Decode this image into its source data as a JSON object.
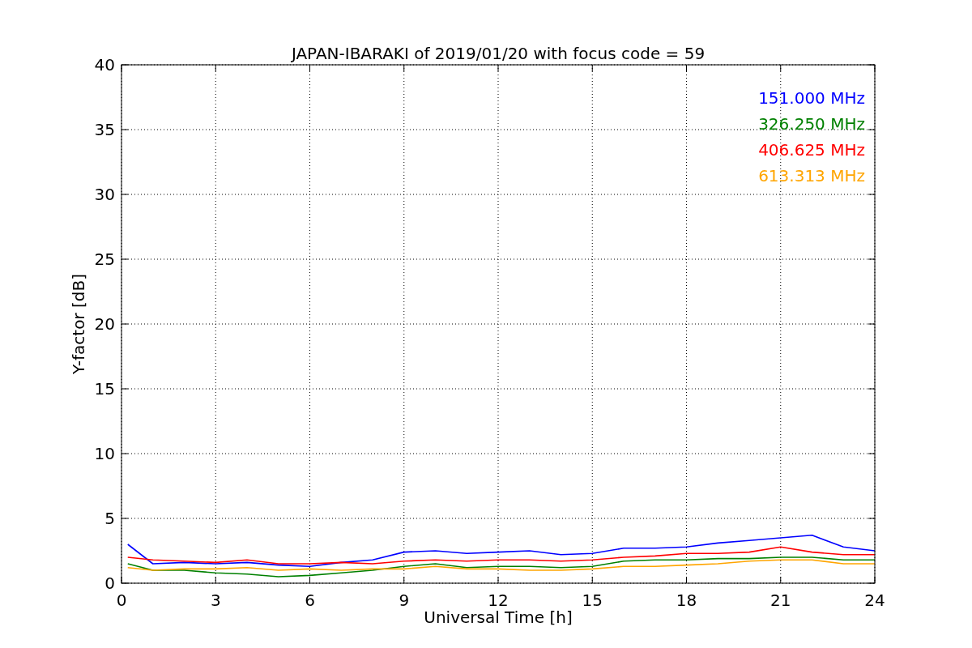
{
  "chart_data": {
    "type": "line",
    "title": "JAPAN-IBARAKI of 2019/01/20 with focus code = 59",
    "xlabel": "Universal Time [h]",
    "ylabel": "Y-factor [dB]",
    "x": [
      0.2,
      1,
      2,
      3,
      4,
      5,
      6,
      7,
      8,
      9,
      10,
      11,
      12,
      13,
      14,
      15,
      16,
      17,
      18,
      19,
      20,
      21,
      22,
      23,
      24
    ],
    "series": [
      {
        "name": "151.000 MHz",
        "color": "#0000ff",
        "values": [
          3.0,
          1.5,
          1.6,
          1.5,
          1.6,
          1.4,
          1.3,
          1.6,
          1.8,
          2.4,
          2.5,
          2.3,
          2.4,
          2.5,
          2.2,
          2.3,
          2.7,
          2.7,
          2.8,
          3.1,
          3.3,
          3.5,
          3.7,
          2.8,
          2.5
        ]
      },
      {
        "name": "326.250 MHz",
        "color": "#008000",
        "values": [
          1.5,
          1.0,
          1.0,
          0.8,
          0.7,
          0.5,
          0.6,
          0.8,
          1.0,
          1.3,
          1.5,
          1.2,
          1.3,
          1.3,
          1.2,
          1.3,
          1.7,
          1.8,
          1.8,
          1.9,
          1.9,
          2.0,
          2.0,
          1.8,
          1.8
        ]
      },
      {
        "name": "406.625 MHz",
        "color": "#ff0000",
        "values": [
          2.0,
          1.8,
          1.7,
          1.6,
          1.8,
          1.5,
          1.5,
          1.6,
          1.5,
          1.7,
          1.8,
          1.7,
          1.8,
          1.8,
          1.7,
          1.8,
          2.0,
          2.1,
          2.3,
          2.3,
          2.4,
          2.8,
          2.4,
          2.2,
          2.2
        ]
      },
      {
        "name": "613.313 MHz",
        "color": "#ffa500",
        "values": [
          1.2,
          1.0,
          1.1,
          1.1,
          1.2,
          1.0,
          1.1,
          1.0,
          1.1,
          1.1,
          1.3,
          1.1,
          1.1,
          1.0,
          1.0,
          1.1,
          1.3,
          1.3,
          1.4,
          1.5,
          1.7,
          1.8,
          1.8,
          1.5,
          1.5
        ]
      }
    ],
    "grid": true,
    "xlim": [
      0,
      24
    ],
    "ylim": [
      0,
      40
    ],
    "xticks": [
      0,
      3,
      6,
      9,
      12,
      15,
      18,
      21,
      24
    ],
    "yticks": [
      0,
      5,
      10,
      15,
      20,
      25,
      30,
      35,
      40
    ]
  }
}
